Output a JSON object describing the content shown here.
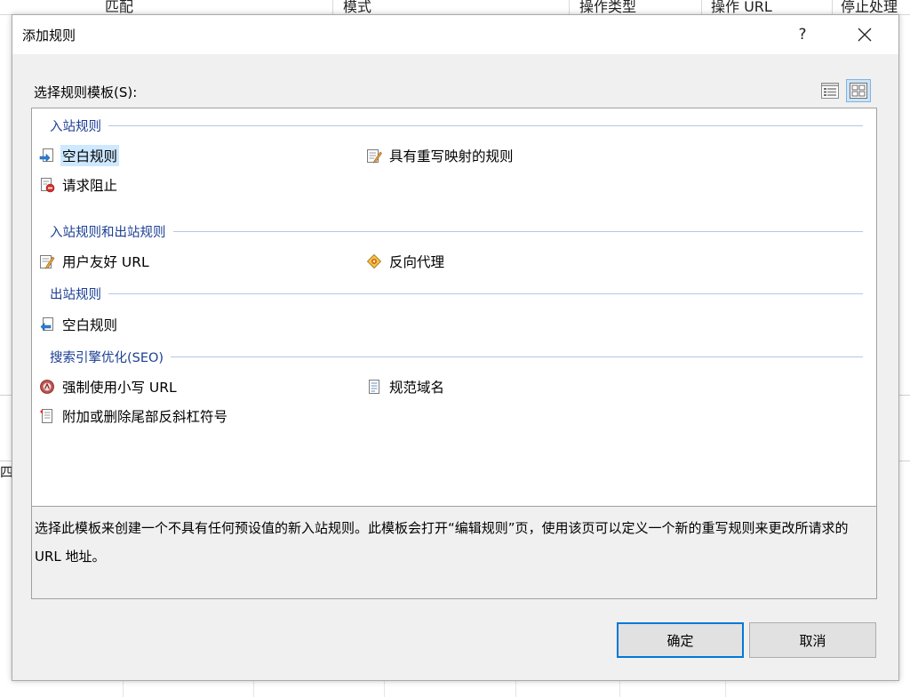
{
  "background": {
    "columns": [
      "匹配",
      "模式",
      "操作类型",
      "操作 URL",
      "停止处理"
    ],
    "side_text": "四"
  },
  "dialog": {
    "title": "添加规则",
    "help_label": "?",
    "close_label": "✕",
    "select_label": "选择规则模板(S):",
    "view_list_icon": "details-view-icon",
    "view_tiles_icon": "tiles-view-icon",
    "groups": [
      {
        "name": "入站规则",
        "items": [
          {
            "label": "空白规则",
            "icon": "blank-inbound-rule-icon",
            "selected": true
          },
          {
            "label": "具有重写映射的规则",
            "icon": "rewrite-map-rule-icon"
          },
          {
            "label": "请求阻止",
            "icon": "request-blocking-icon"
          }
        ]
      },
      {
        "name": "入站规则和出站规则",
        "items": [
          {
            "label": "用户友好 URL",
            "icon": "user-friendly-url-icon"
          },
          {
            "label": "反向代理",
            "icon": "reverse-proxy-icon"
          }
        ]
      },
      {
        "name": "出站规则",
        "items": [
          {
            "label": "空白规则",
            "icon": "blank-outbound-rule-icon"
          }
        ]
      },
      {
        "name": "搜索引擎优化(SEO)",
        "items": [
          {
            "label": "强制使用小写 URL",
            "icon": "lowercase-url-icon"
          },
          {
            "label": "规范域名",
            "icon": "canonical-domain-icon"
          },
          {
            "label": "附加或删除尾部反斜杠符号",
            "icon": "trailing-slash-icon"
          }
        ]
      }
    ],
    "description": "选择此模板来创建一个不具有任何预设值的新入站规则。此模板会打开“编辑规则”页，使用该页可以定义一个新的重写规则来更改所请求的 URL 地址。",
    "ok_label": "确定",
    "cancel_label": "取消",
    "accent_color": "#0078d7",
    "group_header_color": "#1c3f94",
    "selection_color": "#cde8ff"
  }
}
